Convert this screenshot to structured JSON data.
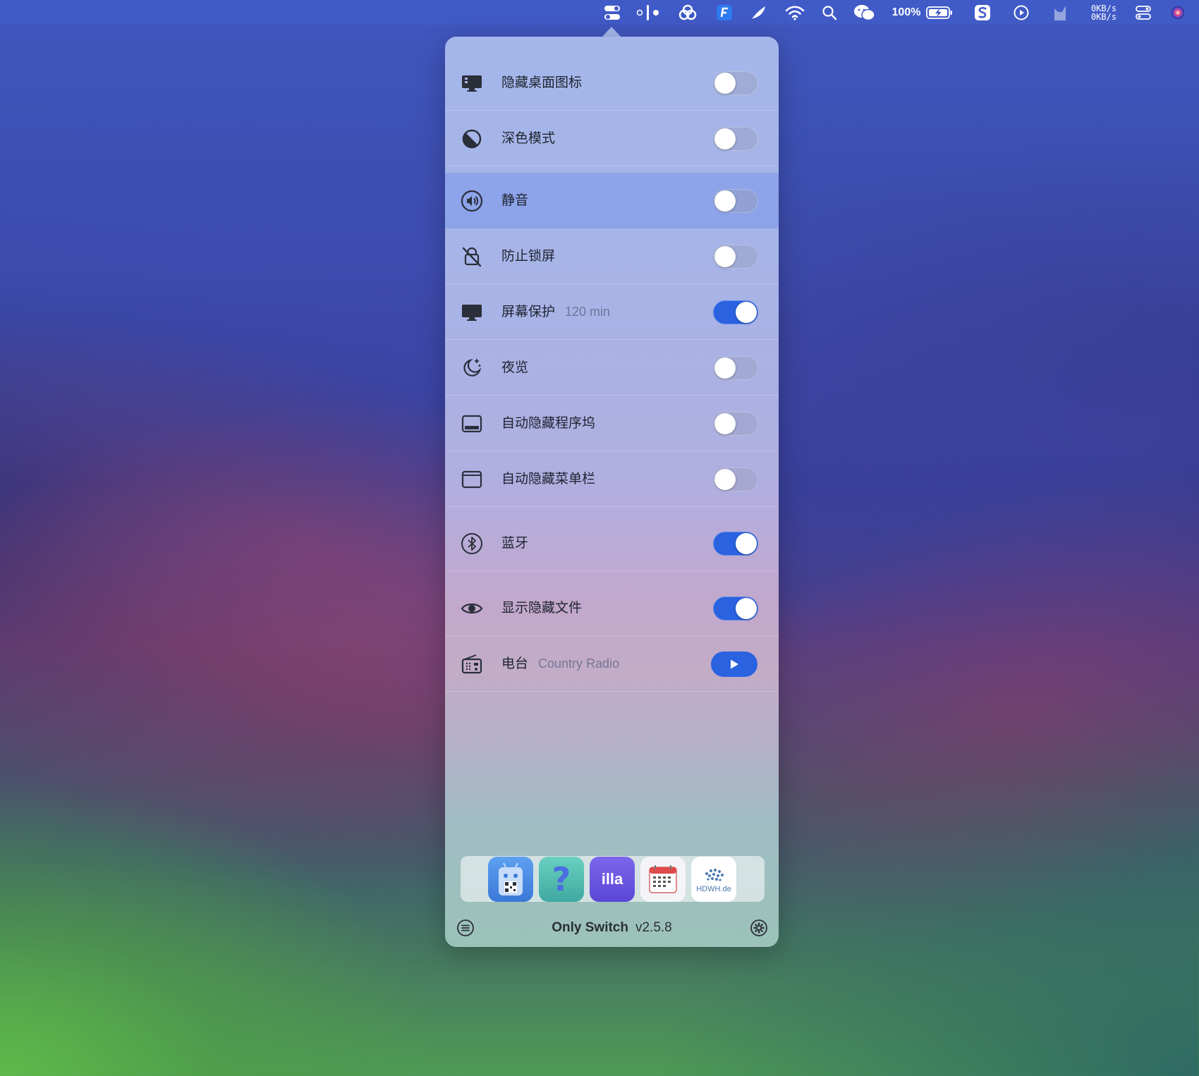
{
  "menubar": {
    "battery_percent": "100%",
    "net_up": "0KB/s",
    "net_down": "0KB/s",
    "icons": [
      "switch-icon",
      "bartender-icon",
      "cloud-icon",
      "app-f-icon",
      "feather-icon",
      "wifi-icon",
      "search-icon",
      "wechat-icon",
      "battery-icon",
      "sogou-icon",
      "play-circle-icon",
      "cat-icon",
      "control-center-icon",
      "siri-icon"
    ]
  },
  "popover": {
    "rows": [
      {
        "label": "隐藏桌面图标",
        "sub": "",
        "icon": "desktop-icon",
        "state": "off"
      },
      {
        "label": "深色模式",
        "sub": "",
        "icon": "dark-mode-icon",
        "state": "off"
      },
      {
        "label": "静音",
        "sub": "",
        "icon": "speaker-icon",
        "state": "off"
      },
      {
        "label": "防止锁屏",
        "sub": "",
        "icon": "lock-slash-icon",
        "state": "off"
      },
      {
        "label": "屏幕保护",
        "sub": "120 min",
        "icon": "display-icon",
        "state": "on"
      },
      {
        "label": "夜览",
        "sub": "",
        "icon": "moon-icon",
        "state": "off"
      },
      {
        "label": "自动隐藏程序坞",
        "sub": "",
        "icon": "dock-icon",
        "state": "off"
      },
      {
        "label": "自动隐藏菜单栏",
        "sub": "",
        "icon": "menubar-window-icon",
        "state": "off"
      },
      {
        "label": "蓝牙",
        "sub": "",
        "icon": "bluetooth-icon",
        "state": "on"
      },
      {
        "label": "显示隐藏文件",
        "sub": "",
        "icon": "eye-icon",
        "state": "on"
      },
      {
        "label": "电台",
        "sub": "Country Radio",
        "icon": "radio-icon",
        "state": "play"
      }
    ],
    "apps": [
      {
        "name": "robot-qr-app-icon",
        "label": ""
      },
      {
        "name": "help-app-icon",
        "label": "?"
      },
      {
        "name": "illa-app-icon",
        "label": "illa"
      },
      {
        "name": "calendar-app-icon",
        "label": ""
      },
      {
        "name": "hdwh-app-icon",
        "label": "HDWH.de"
      }
    ],
    "footer": {
      "title": "Only Switch",
      "version": "v2.5.8"
    }
  },
  "colors": {
    "accent": "#2a62e0",
    "menubar": "#415ac8"
  }
}
